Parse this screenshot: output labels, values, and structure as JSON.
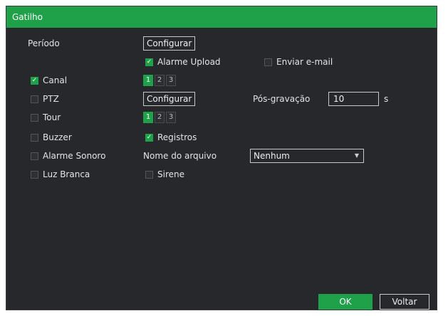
{
  "title": "Gatilho",
  "periodo": {
    "label": "Período",
    "button": "Configurar"
  },
  "alarme_upload": {
    "label": "Alarme Upload",
    "checked": true
  },
  "enviar_email": {
    "label": "Enviar e-mail",
    "checked": false
  },
  "canal": {
    "label": "Canal",
    "checked": true,
    "pages": [
      "1",
      "2",
      "3"
    ],
    "active_page": "1"
  },
  "ptz": {
    "label": "PTZ",
    "checked": false,
    "button": "Configurar"
  },
  "pos_gravacao": {
    "label": "Pós-gravação",
    "value": "10",
    "unit": "s"
  },
  "tour": {
    "label": "Tour",
    "checked": false,
    "pages": [
      "1",
      "2",
      "3"
    ],
    "active_page": "1"
  },
  "buzzer": {
    "label": "Buzzer",
    "checked": false
  },
  "registros": {
    "label": "Registros",
    "checked": true
  },
  "alarme_sonoro": {
    "label": "Alarme Sonoro",
    "checked": false
  },
  "nome_arquivo": {
    "label": "Nome do arquivo",
    "selected": "Nenhum"
  },
  "luz_branca": {
    "label": "Luz Branca",
    "checked": false
  },
  "sirene": {
    "label": "Sirene",
    "checked": false
  },
  "footer": {
    "ok": "OK",
    "cancel": "Voltar"
  },
  "colors": {
    "accent": "#1ea148",
    "background": "#26282c"
  }
}
